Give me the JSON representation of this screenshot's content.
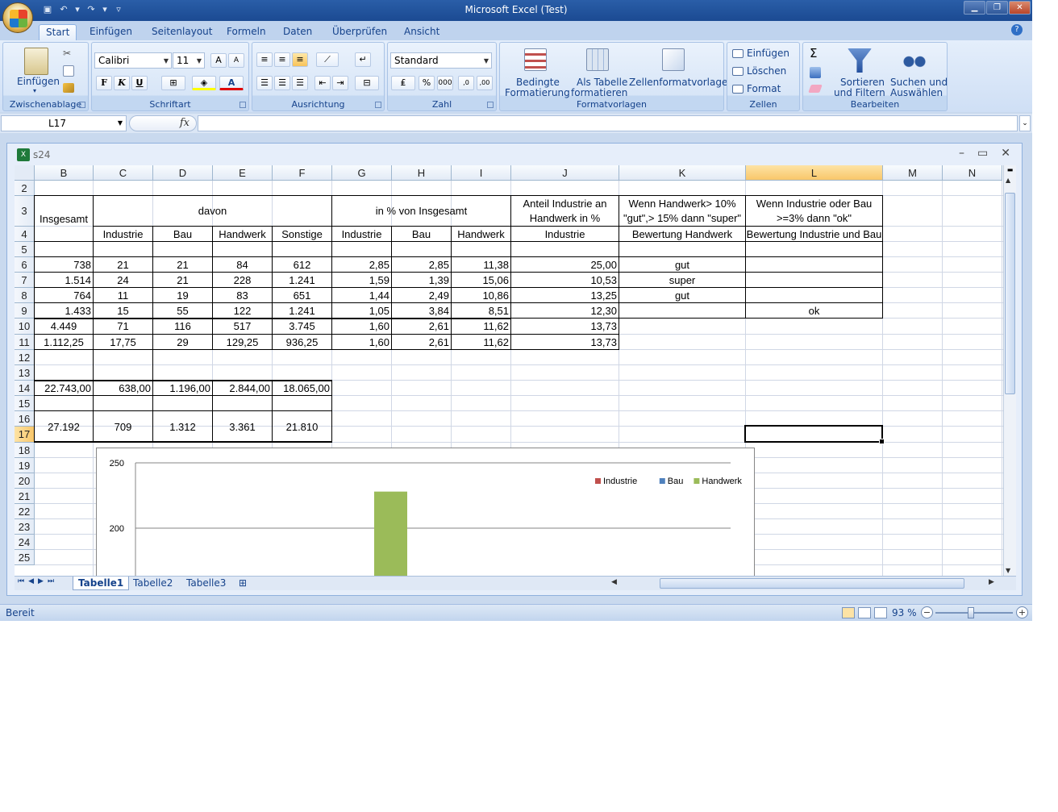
{
  "window": {
    "title": "Microsoft Excel (Test)"
  },
  "ribbon_tabs": [
    "Start",
    "Einfügen",
    "Seitenlayout",
    "Formeln",
    "Daten",
    "Überprüfen",
    "Ansicht"
  ],
  "ribbon": {
    "clipboard": {
      "label": "Zwischenablage",
      "paste": "Einfügen"
    },
    "font": {
      "label": "Schriftart",
      "name": "Calibri",
      "size": "11"
    },
    "alignment": {
      "label": "Ausrichtung"
    },
    "number": {
      "label": "Zahl",
      "format": "Standard"
    },
    "styles": {
      "label": "Formatvorlagen",
      "cond1": "Bedingte",
      "cond2": "Formatierung",
      "table1": "Als Tabelle",
      "table2": "formatieren",
      "cellstyles": "Zellenformatvorlagen"
    },
    "cells": {
      "label": "Zellen",
      "insert": "Einfügen",
      "delete": "Löschen",
      "format": "Format"
    },
    "editing": {
      "label": "Bearbeiten",
      "sort1": "Sortieren",
      "sort2": "und Filtern",
      "find1": "Suchen und",
      "find2": "Auswählen"
    }
  },
  "formula_bar": {
    "name_box": "L17",
    "fx": "fx",
    "formula": ""
  },
  "workbook": {
    "title": "s24"
  },
  "columns": [
    "B",
    "C",
    "D",
    "E",
    "F",
    "G",
    "H",
    "I",
    "J",
    "K",
    "L",
    "M",
    "N"
  ],
  "rows": [
    "2",
    "3",
    "4",
    "5",
    "6",
    "7",
    "8",
    "9",
    "10",
    "11",
    "12",
    "13",
    "14",
    "15",
    "16",
    "17",
    "18",
    "19",
    "20",
    "21",
    "22",
    "23",
    "24",
    "25"
  ],
  "headers": {
    "insgesamt": "Insgesamt",
    "davon": "davon",
    "prozent": "in % von Insgesamt",
    "anteil1": "Anteil Industrie an",
    "anteil2": "Handwerk in %",
    "wenn_hw1": "Wenn Handwerk> 10%",
    "wenn_hw2": "\"gut\",> 15% dann \"super\"",
    "wenn_ib1": "Wenn Industrie oder Bau",
    "wenn_ib2": ">=3% dann \"ok\"",
    "row4": [
      "Industrie",
      "Bau",
      "Handwerk",
      "Sonstige",
      "Industrie",
      "Bau",
      "Handwerk",
      "Industrie",
      "Bewertung Handwerk",
      "Bewertung Industrie und Bau"
    ]
  },
  "table_rows": [
    {
      "B": "738",
      "C": "21",
      "D": "21",
      "E": "84",
      "F": "612",
      "G": "2,85",
      "H": "2,85",
      "I": "11,38",
      "J": "25,00",
      "K": "gut",
      "L": ""
    },
    {
      "B": "1.514",
      "C": "24",
      "D": "21",
      "E": "228",
      "F": "1.241",
      "G": "1,59",
      "H": "1,39",
      "I": "15,06",
      "J": "10,53",
      "K": "super",
      "L": ""
    },
    {
      "B": "764",
      "C": "11",
      "D": "19",
      "E": "83",
      "F": "651",
      "G": "1,44",
      "H": "2,49",
      "I": "10,86",
      "J": "13,25",
      "K": "gut",
      "L": ""
    },
    {
      "B": "1.433",
      "C": "15",
      "D": "55",
      "E": "122",
      "F": "1.241",
      "G": "1,05",
      "H": "3,84",
      "I": "8,51",
      "J": "12,30",
      "K": "",
      "L": "ok"
    },
    {
      "B": "4.449",
      "C": "71",
      "D": "116",
      "E": "517",
      "F": "3.745",
      "G": "1,60",
      "H": "2,61",
      "I": "11,62",
      "J": "13,73",
      "K": "",
      "L": ""
    },
    {
      "B": "1.112,25",
      "C": "17,75",
      "D": "29",
      "E": "129,25",
      "F": "936,25",
      "G": "1,60",
      "H": "2,61",
      "I": "11,62",
      "J": "13,73",
      "K": "",
      "L": ""
    }
  ],
  "row14": {
    "B": "22.743,00",
    "C": "638,00",
    "D": "1.196,00",
    "E": "2.844,00",
    "F": "18.065,00"
  },
  "row17": {
    "B": "27.192",
    "C": "709",
    "D": "1.312",
    "E": "3.361",
    "F": "21.810"
  },
  "chart_data": {
    "type": "bar",
    "series": [
      {
        "name": "Industrie",
        "color": "#c0504d"
      },
      {
        "name": "Bau",
        "color": "#4f81bd"
      },
      {
        "name": "Handwerk",
        "color": "#9bbb59"
      }
    ],
    "visible_bar": {
      "series": "Handwerk",
      "value": 228
    },
    "y_ticks_visible": [
      200,
      250
    ],
    "legend_position": "top-right"
  },
  "sheet_tabs": [
    "Tabelle1",
    "Tabelle2",
    "Tabelle3"
  ],
  "status": {
    "ready": "Bereit",
    "zoom": "93 %"
  }
}
